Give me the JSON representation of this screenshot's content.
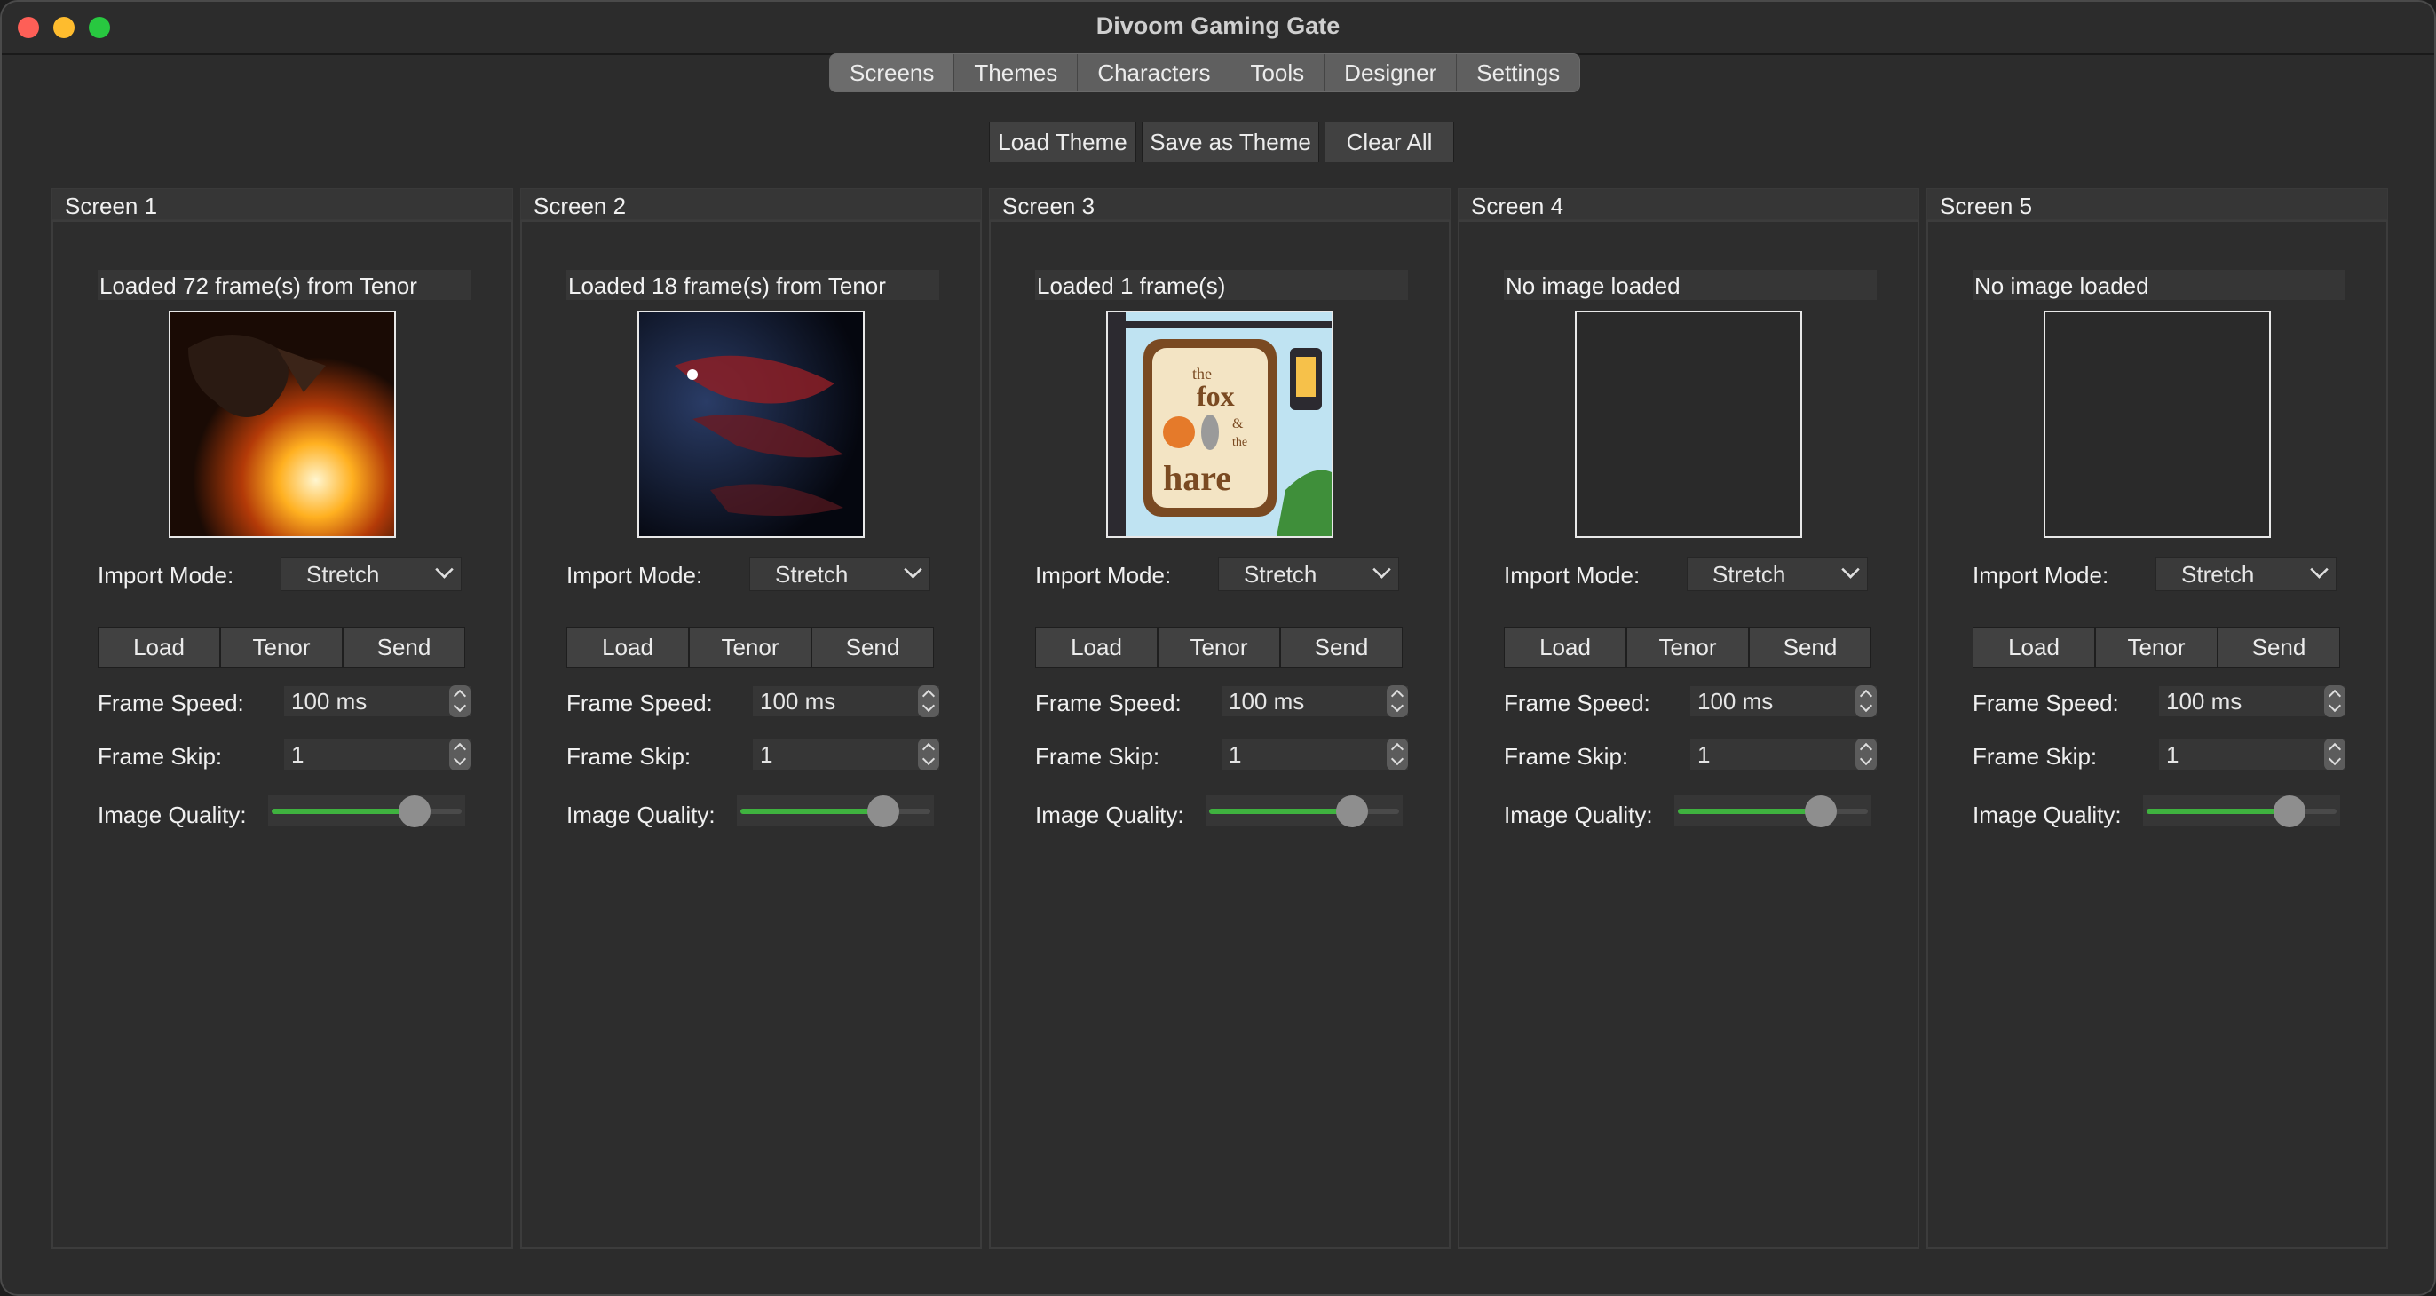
{
  "window": {
    "title": "Divoom Gaming Gate"
  },
  "tabs": [
    "Screens",
    "Themes",
    "Characters",
    "Tools",
    "Designer",
    "Settings"
  ],
  "active_tab": "Screens",
  "toolbar": {
    "load_theme": "Load Theme",
    "save_theme": "Save as Theme",
    "clear_all": "Clear All"
  },
  "labels": {
    "import_mode": "Import Mode:",
    "frame_speed": "Frame Speed:",
    "frame_skip": "Frame Skip:",
    "image_quality": "Image Quality:",
    "load": "Load",
    "tenor": "Tenor",
    "send": "Send"
  },
  "colors": {
    "accent_green": "#3fb23f"
  },
  "screens": [
    {
      "title": "Screen 1",
      "status": "Loaded 72 frame(s) from Tenor",
      "preview": "fire-dragon",
      "import_mode": "Stretch",
      "frame_speed": "100 ms",
      "frame_skip": "1",
      "quality_fraction": 0.75
    },
    {
      "title": "Screen 2",
      "status": "Loaded 18 frame(s) from Tenor",
      "preview": "red-dragon",
      "import_mode": "Stretch",
      "frame_speed": "100 ms",
      "frame_skip": "1",
      "quality_fraction": 0.75
    },
    {
      "title": "Screen 3",
      "status": "Loaded 1 frame(s)",
      "preview": "fox-and-hare-sign",
      "sign_text": [
        "the",
        "fox",
        "&",
        "the",
        "hare"
      ],
      "import_mode": "Stretch",
      "frame_speed": "100 ms",
      "frame_skip": "1",
      "quality_fraction": 0.75
    },
    {
      "title": "Screen 4",
      "status": "No image loaded",
      "preview": "empty",
      "import_mode": "Stretch",
      "frame_speed": "100 ms",
      "frame_skip": "1",
      "quality_fraction": 0.75
    },
    {
      "title": "Screen 5",
      "status": "No image loaded",
      "preview": "empty",
      "import_mode": "Stretch",
      "frame_speed": "100 ms",
      "frame_skip": "1",
      "quality_fraction": 0.75
    }
  ]
}
